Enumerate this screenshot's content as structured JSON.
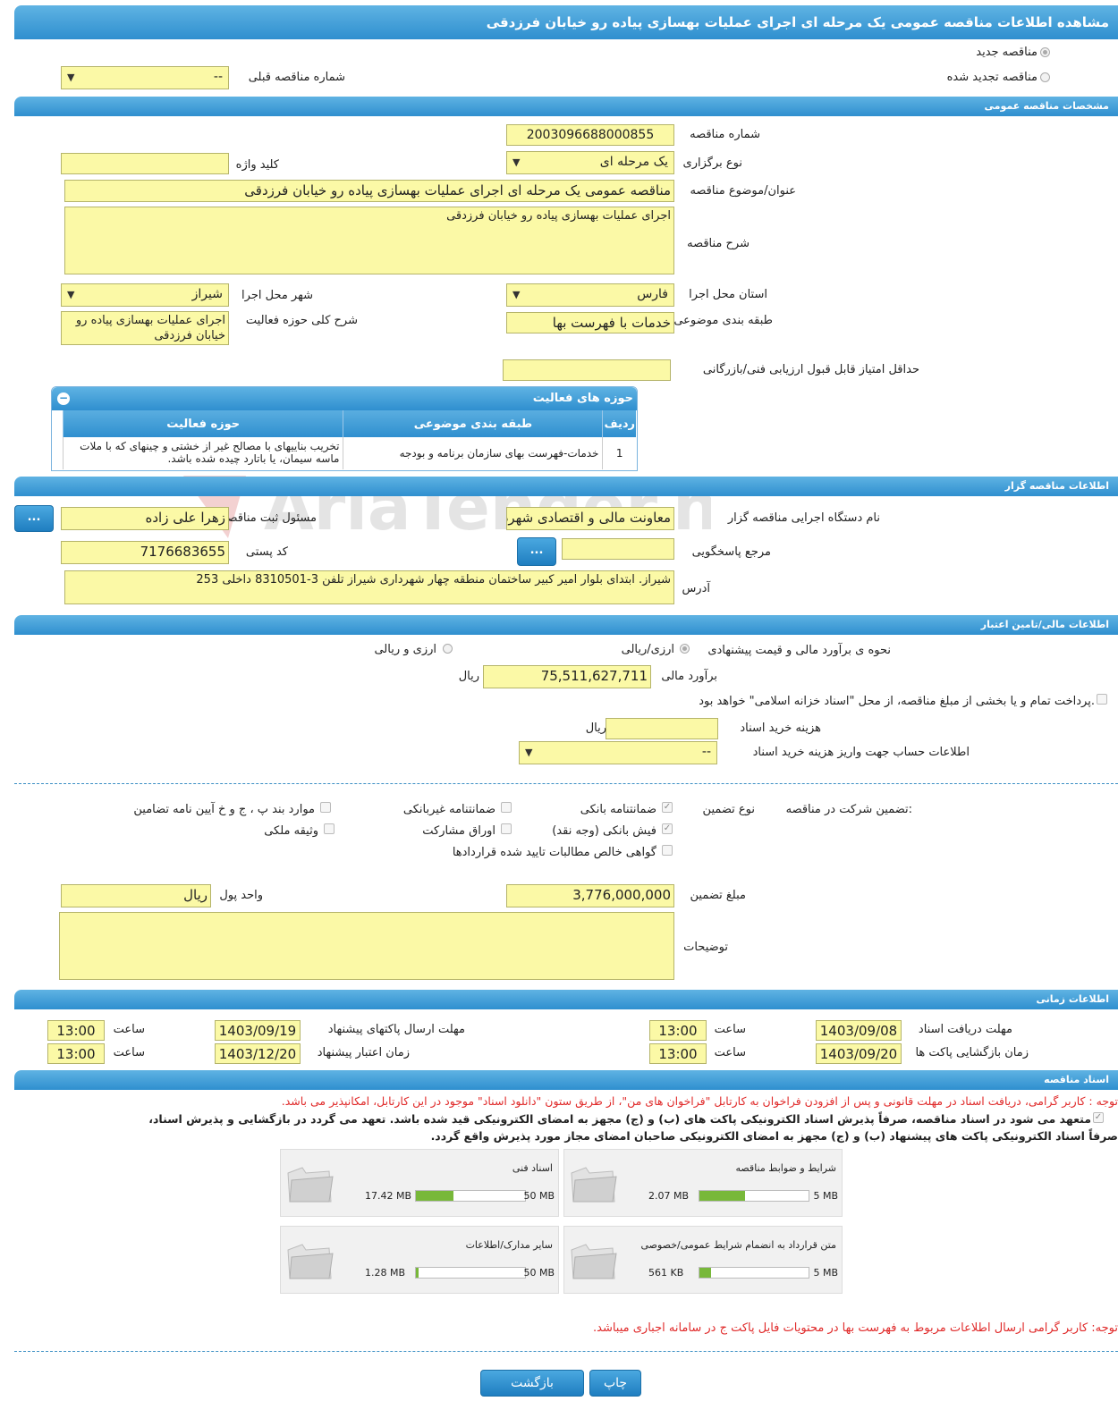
{
  "header": {
    "title": "مشاهده اطلاعات مناقصه عمومی یک مرحله ای اجرای عملیات بهسازی پیاده رو خیابان فرزدقی"
  },
  "tender_type": {
    "new_label": "مناقصه جدید",
    "renewed_label": "مناقصه تجدید شده",
    "prev_number_label": "شماره مناقصه قبلی",
    "prev_number_value": "--"
  },
  "general": {
    "section_title": "مشخصات مناقصه عمومی",
    "number_label": "شماره مناقصه",
    "number_value": "2003096688000855",
    "holding_type_label": "نوع برگزاری",
    "holding_type_value": "یک مرحله ای",
    "keyword_label": "کلید واژه",
    "keyword_value": "",
    "subject_label": "عنوان/موضوع مناقصه",
    "subject_value": "مناقصه عمومی یک مرحله ای اجرای عملیات بهسازی پیاده رو خیابان فرزدقی",
    "desc_label": "شرح مناقصه",
    "desc_value": "اجرای عملیات بهسازی پیاده رو خیابان فرزدقی",
    "province_label": "استان محل اجرا",
    "province_value": "فارس",
    "city_label": "شهر محل اجرا",
    "city_value": "شیراز",
    "category_label": "طبقه بندی موضوعی",
    "category_value": "خدمات با فهرست بها",
    "activity_desc_label": "شرح کلی حوزه فعالیت",
    "activity_desc_value": "اجرای عملیات بهسازی پیاده رو خیابان فرزدقی",
    "min_score_label": "حداقل امتیاز قابل قبول ارزیابی فنی/بازرگانی",
    "min_score_value": ""
  },
  "activities": {
    "title": "حوزه های فعالیت",
    "toggle": "−",
    "columns": [
      "ردیف",
      "طبقه بندی موضوعی",
      "حوزه فعالیت"
    ],
    "rows": [
      [
        "1",
        "خدمات-فهرست بهای سازمان برنامه و بودجه",
        "تخریب بناییهای با مصالح غیر از خشتی و چینهای که با ملات ماسه سیمان، یا باتارد چیده شده باشد."
      ]
    ]
  },
  "organizer": {
    "section_title": "اطلاعات مناقصه گزار",
    "org_label": "نام دستگاه اجرایی مناقصه گزار",
    "org_value": "معاونت مالی و اقتصادی شهرداری",
    "responsible_label": "مسئول ثبت مناقصه",
    "responsible_value": "زهرا علی زاده",
    "ref_label": "مرجع پاسخگویی",
    "ref_value": "",
    "postal_label": "کد پستی",
    "postal_value": "7176683655",
    "address_label": "آدرس",
    "address_value": "شیراز. ابتدای بلوار امیر کبیر ساختمان منطقه چهار شهرداری شیراز تلفن 3-8310501 داخلی 253",
    "dots": "..."
  },
  "finance": {
    "section_title": "اطلاعات مالی/تامین اعتبار",
    "method_label": "نحوه ی برآورد مالی و قیمت پیشنهادی",
    "opt_rial": "ارزی/ریالی",
    "opt_fx": "ارزی و ریالی",
    "estimate_label": "برآورد مالی",
    "estimate_value": "75,511,627,711",
    "estimate_unit": "ریال",
    "treasury_text": "پرداخت تمام و یا بخشی از مبلغ مناقصه، از محل \"اسناد خزانه اسلامی\" خواهد بود.",
    "doc_fee_label": "هزینه خرید اسناد",
    "doc_fee_value": "",
    "doc_fee_unit": "ریال",
    "account_label": "اطلاعات حساب جهت واریز هزینه خرید اسناد",
    "account_value": "--"
  },
  "guarantee": {
    "title_label": "تضمین شرکت در مناقصه:",
    "type_label": "نوع تضمین",
    "options": [
      {
        "label": "ضمانتنامه بانکی",
        "checked": true
      },
      {
        "label": "ضمانتنامه غیربانکی",
        "checked": false
      },
      {
        "label": "موارد بند پ ، ج و خ آیین نامه تضامین",
        "checked": false
      },
      {
        "label": "فیش بانکی (وجه نقد)",
        "checked": true
      },
      {
        "label": "اوراق مشارکت",
        "checked": false
      },
      {
        "label": "وثیقه ملکی",
        "checked": false
      },
      {
        "label": "گواهی خالص مطالبات تایید شده قراردادها",
        "checked": false
      }
    ],
    "amount_label": "مبلغ تضمین",
    "amount_value": "3,776,000,000",
    "currency_label": "واحد پول",
    "currency_value": "ریال",
    "notes_label": "توضیحات",
    "notes_value": ""
  },
  "timing": {
    "section_title": "اطلاعات زمانی",
    "doc_receipt_label": "مهلت دریافت اسناد",
    "doc_receipt_date": "1403/09/08",
    "doc_receipt_time": "13:00",
    "send_label": "مهلت ارسال پاکتهای پیشنهاد",
    "send_date": "1403/09/19",
    "send_time": "13:00",
    "open_label": "زمان بازگشایی پاکت ها",
    "open_date": "1403/09/20",
    "open_time": "13:00",
    "validity_label": "زمان اعتبار پیشنهاد",
    "validity_date": "1403/12/20",
    "validity_time": "13:00",
    "hour_label": "ساعت"
  },
  "documents": {
    "section_title": "اسناد مناقصه",
    "notice1": "توجه : کاربر گرامی، دریافت اسناد در مهلت قانونی و پس از افزودن فراخوان به کارتابل \"فراخوان های من\"، از طریق ستون \"دانلود اسناد\" موجود در این کارتابل، امکانپذیر می باشد.",
    "commit_line1": "متعهد می شود در اسناد مناقصه، صرفاً پذیرش اسناد الکترونیکی پاکت های (ب) و (ج) مجهز به امضای الکترونیکی قید شده باشد. تعهد می گردد در بازگشایی و پذیرش اسناد،",
    "commit_line2": "صرفاً اسناد الکترونیکی پاکت های پیشنهاد (ب) و (ج) مجهز به امضای الکترونیکی صاحبان امضای مجاز مورد پذیرش واقع گردد.",
    "files": [
      {
        "title": "شرایط و ضوابط مناقصه",
        "size": "2.07 MB",
        "max": "5 MB",
        "fill": 0.414
      },
      {
        "title": "اسناد فنی",
        "size": "17.42 MB",
        "max": "50 MB",
        "fill": 0.348
      },
      {
        "title": "متن قرارداد به انضمام شرایط عمومی/خصوصی",
        "size": "561 KB",
        "max": "5 MB",
        "fill": 0.11
      },
      {
        "title": "سایر مدارک/اطلاعات",
        "size": "1.28 MB",
        "max": "50 MB",
        "fill": 0.026
      }
    ],
    "notice2": "توجه: کاربر گرامی ارسال اطلاعات مربوط به فهرست بها در محتویات فایل پاکت ج در سامانه اجباری میباشد."
  },
  "footer": {
    "print_label": "چاپ",
    "back_label": "بازگشت"
  },
  "watermark": "AriaTender.neT"
}
